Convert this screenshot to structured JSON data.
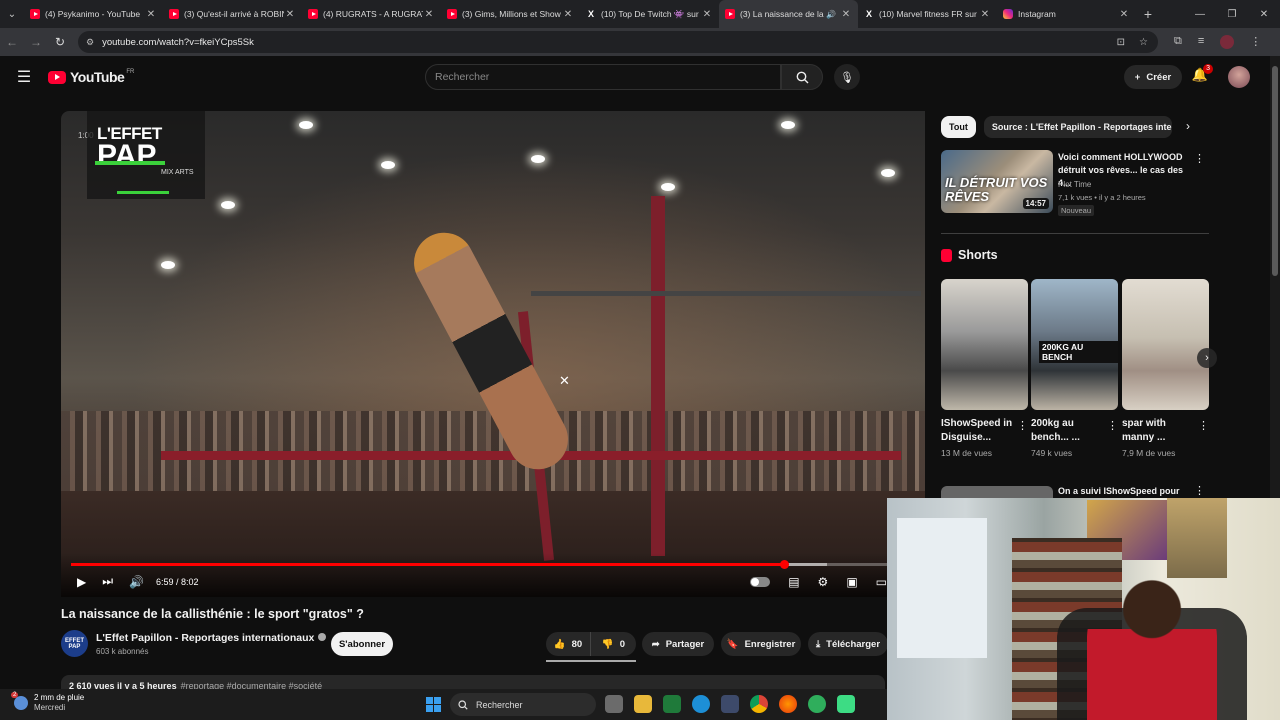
{
  "browser": {
    "tabs": [
      {
        "label": "(4) Psykanimo - YouTube",
        "icon": "youtube-icon"
      },
      {
        "label": "(3) Qu'est-il arrivé à ROBIN",
        "icon": "youtube-icon"
      },
      {
        "label": "(4) RUGRATS - A RUGRAT",
        "icon": "youtube-icon"
      },
      {
        "label": "(3) Gims, Millions et Show",
        "icon": "youtube-icon"
      },
      {
        "label": "(10) Top De Twitch 👾 sur",
        "icon": "x-icon"
      },
      {
        "label": "(3) La naissance de la",
        "icon": "youtube-icon",
        "active": true
      },
      {
        "label": "(10) Marvel fitness FR sur",
        "icon": "x-icon"
      },
      {
        "label": "Instagram",
        "icon": "instagram-icon"
      }
    ],
    "url": "youtube.com/watch?v=fkeiYCps5Sk"
  },
  "header": {
    "logo_text": "YouTube",
    "logo_region": "FR",
    "search_placeholder": "Rechercher",
    "create_label": "Créer",
    "notification_count": "3"
  },
  "video": {
    "watermark_line1": "L'EFFET",
    "watermark_line2": "PAP",
    "watermark_line3": "MIX   ARTS",
    "overlay_time": "1:00",
    "current_time": "6:59 / 8:02",
    "progress_fraction": 0.87,
    "title": "La naissance de la callisthénie : le sport \"gratos\" ?",
    "channel_name": "L'Effet Papillon - Reportages internationaux",
    "channel_avatar_text": "EFFET PAP",
    "subscribers": "603 k abonnés",
    "subscribe_label": "S'abonner",
    "likes": "80",
    "dislikes": "0",
    "share_label": "Partager",
    "save_label": "Enregistrer",
    "download_label": "Télécharger",
    "description_stats": "2 610 vues  il y a 5 heures",
    "description_tags": "#reportage #documentaire #société"
  },
  "sidebar": {
    "chips": [
      "Tout",
      "Source : L'Effet Papillon - Reportages interna"
    ],
    "recommended": {
      "title": "Voici comment HOLLYWOOD détruit vos rêves... le cas des 4...",
      "thumb_text": "IL DÉTRUIT VOS RÊVES",
      "duration": "14:57",
      "channel": "Plot Time",
      "meta": "7,1 k vues • il y a 2 heures",
      "badge": "Nouveau"
    },
    "shorts_title": "Shorts",
    "shorts": [
      {
        "title": "IShowSpeed in Disguise...",
        "views": "13 M de vues",
        "thumb_text": ""
      },
      {
        "title": "200kg au bench... ...",
        "views": "749 k vues",
        "thumb_text": "200KG AU BENCH"
      },
      {
        "title": "spar with manny ...",
        "views": "7,9 M de vues",
        "thumb_text": ""
      }
    ],
    "next_title": "On a suivi IShowSpeed pour"
  },
  "taskbar": {
    "weather_line1": "2 mm de pluie",
    "weather_line2": "Mercredi",
    "weather_badge": "2",
    "search_label": "Rechercher"
  }
}
